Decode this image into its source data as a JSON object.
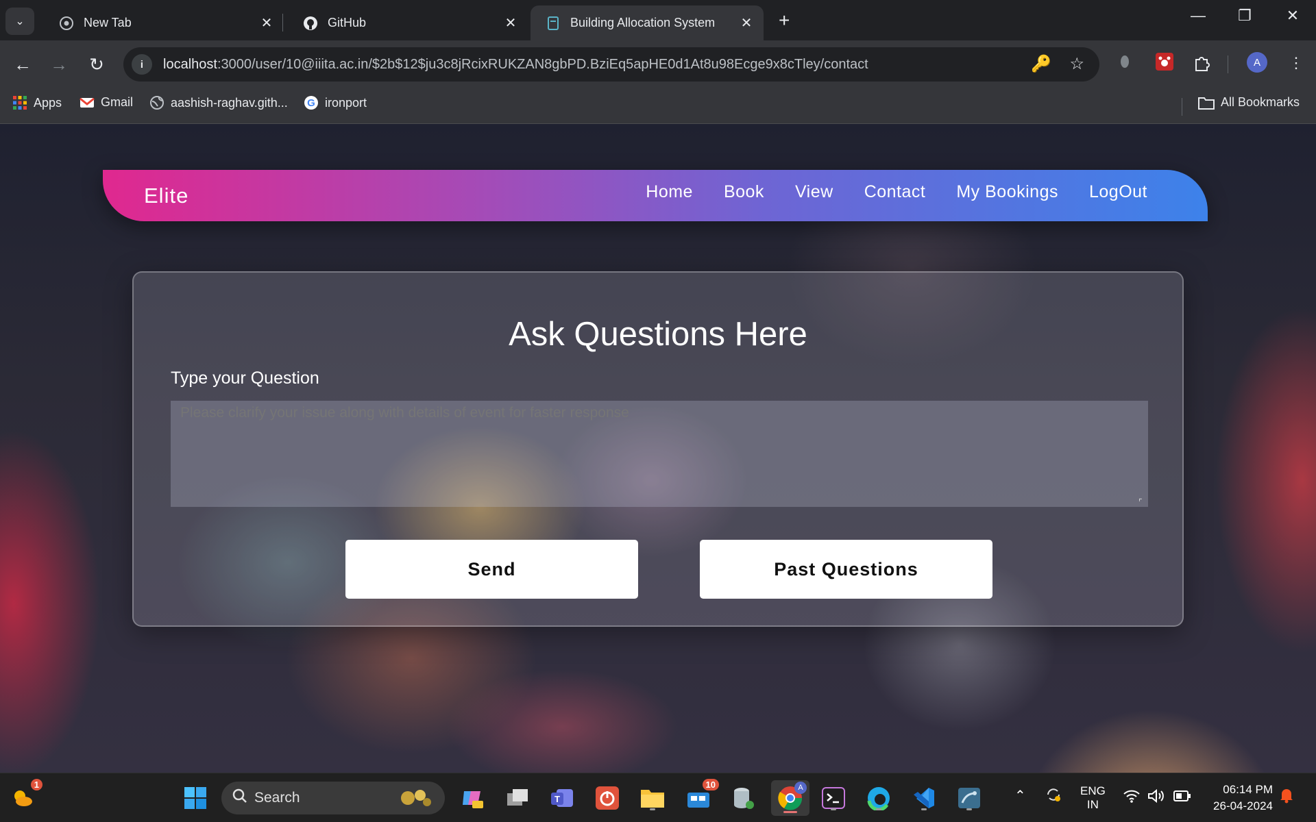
{
  "browser": {
    "tabs": [
      {
        "title": "New Tab",
        "icon": "chrome-icon",
        "active": false
      },
      {
        "title": "GitHub",
        "icon": "github-icon",
        "active": false
      },
      {
        "title": "Building Allocation System",
        "icon": "page-icon",
        "active": true
      }
    ],
    "url_host": "localhost",
    "url_path": ":3000/user/10@iiita.ac.in/$2b$12$ju3c8jRcixRUKZAN8gbPD.BziEq5apHE0d1At8u98Ecge9x8cTley/contact",
    "profile_initial": "A",
    "bookmarks": [
      {
        "label": "Apps",
        "icon": "apps-grid-icon"
      },
      {
        "label": "Gmail",
        "icon": "gmail-icon"
      },
      {
        "label": "aashish-raghav.gith...",
        "icon": "globe-icon"
      },
      {
        "label": "ironport",
        "icon": "google-icon"
      }
    ],
    "all_bookmarks": "All Bookmarks"
  },
  "site": {
    "brand": "Elite",
    "nav": [
      "Home",
      "Book",
      "View",
      "Contact",
      "My Bookings",
      "LogOut"
    ],
    "form": {
      "heading": "Ask Questions Here",
      "label": "Type your Question",
      "placeholder": "Please clarify your issue along with details of event for faster response",
      "send_label": "Send",
      "past_label": "Past Questions"
    },
    "colors": {
      "nav_start": "#e0288f",
      "nav_end": "#3d82ea"
    }
  },
  "taskbar": {
    "search_label": "Search",
    "weather_badge": "1",
    "store_badge": "10",
    "lang_top": "ENG",
    "lang_bottom": "IN",
    "time": "06:14 PM",
    "date": "26-04-2024"
  }
}
